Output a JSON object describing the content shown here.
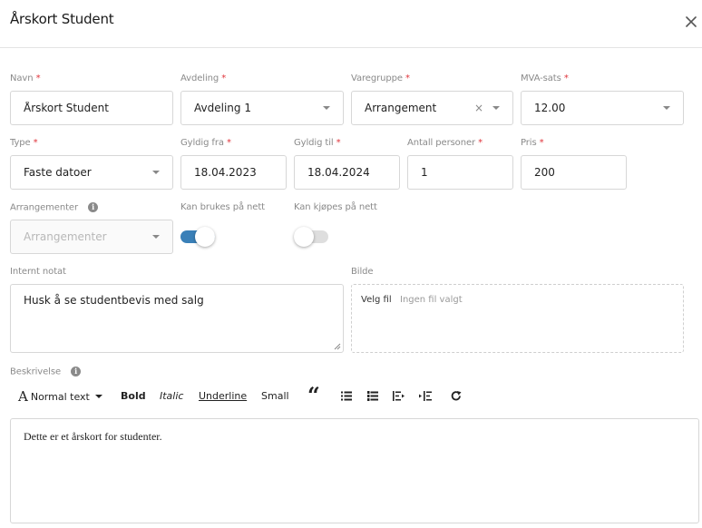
{
  "modal": {
    "title": "Årskort Student"
  },
  "form": {
    "required_mark": "*",
    "navn": {
      "label": "Navn",
      "value": "Årskort Student"
    },
    "avdeling": {
      "label": "Avdeling",
      "value": "Avdeling 1"
    },
    "varegruppe": {
      "label": "Varegruppe",
      "value": "Arrangement",
      "clear": "×"
    },
    "mva": {
      "label": "MVA-sats",
      "value": "12.00"
    },
    "type": {
      "label": "Type",
      "value": "Faste datoer"
    },
    "gyldig_fra": {
      "label": "Gyldig fra",
      "value": "18.04.2023"
    },
    "gyldig_til": {
      "label": "Gyldig til",
      "value": "18.04.2024"
    },
    "antall": {
      "label": "Antall personer",
      "value": "1"
    },
    "pris": {
      "label": "Pris",
      "value": "200"
    },
    "arrangementer": {
      "label": "Arrangementer",
      "placeholder": "Arrangementer"
    },
    "kan_brukes": {
      "label": "Kan brukes på nett",
      "on": true
    },
    "kan_kjopes": {
      "label": "Kan kjøpes på nett",
      "on": false
    },
    "internt_notat": {
      "label": "Internt notat",
      "value": "Husk å se studentbevis med salg"
    },
    "bilde": {
      "label": "Bilde",
      "button": "Velg fil",
      "status": "Ingen fil valgt"
    },
    "beskrivelse": {
      "label": "Beskrivelse",
      "value": "Dette er et årskort for studenter."
    }
  },
  "toolbar": {
    "font_glyph": "A",
    "text_style": "Normal text",
    "bold": "Bold",
    "italic": "Italic",
    "underline": "Underline",
    "small": "Small",
    "quote": "66"
  },
  "colors": {
    "accent": "#3a80b8",
    "required": "#e0353c",
    "label": "#8a8a8a",
    "border": "#d7d7d7"
  },
  "icons": [
    "close-icon",
    "info-icon",
    "chevron-down-icon",
    "blockquote-icon",
    "unordered-list-icon",
    "ordered-list-icon",
    "outdent-icon",
    "indent-icon",
    "redo-icon"
  ]
}
